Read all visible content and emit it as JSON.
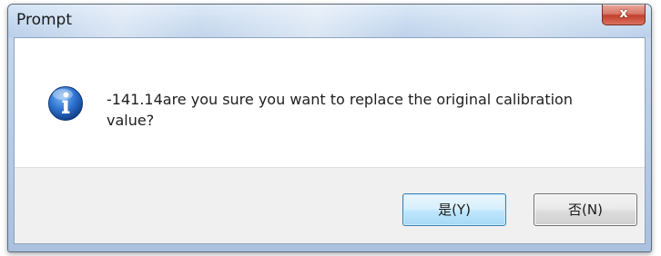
{
  "window": {
    "title": "Prompt",
    "close_glyph": "x"
  },
  "dialog": {
    "icon": "info-icon",
    "message": "-141.14are you sure you want to replace the original calibration value?"
  },
  "buttons": {
    "yes_label": "是(Y)",
    "no_label": "否(N)"
  },
  "colors": {
    "title_bar": "#c3d7ee",
    "close_button": "#c2412e",
    "footer": "#f0f0f0",
    "info_icon": "#1f63c4",
    "default_button_border": "#3c7fb1"
  }
}
